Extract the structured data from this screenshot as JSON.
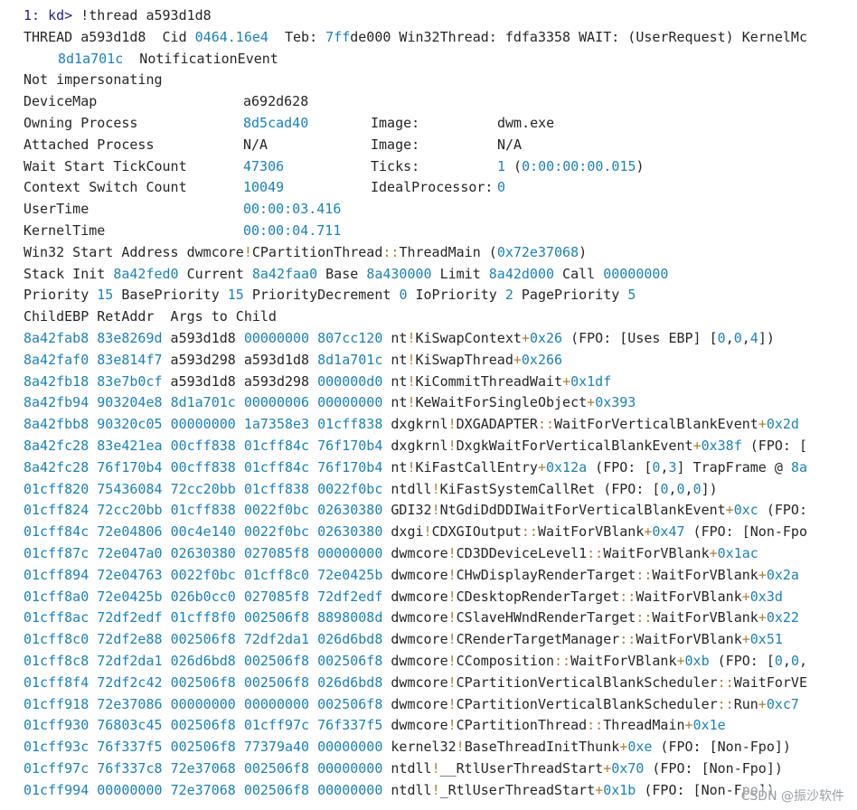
{
  "prompt": "1: kd>",
  "command": "!thread a593d1d8",
  "thread_header": [
    [
      [
        "t",
        "THREAD a593d1d8  Cid "
      ],
      [
        "n",
        "0464.16e4"
      ],
      [
        "t",
        "  Teb: "
      ],
      [
        "n",
        "7ff"
      ],
      [
        "t",
        "de000 Win32Thread: fdfa3358 WAIT: (UserRequest) KernelMc"
      ]
    ],
    [
      [
        "n",
        "8d1a701c"
      ],
      [
        "t",
        "  NotificationEvent"
      ]
    ],
    [
      [
        "t",
        "Not impersonating"
      ]
    ]
  ],
  "props": [
    {
      "label": "DeviceMap",
      "value": "a692d628",
      "value_color": "t",
      "label2": "",
      "value2": ""
    },
    {
      "label": "Owning Process",
      "value": "8d5cad40",
      "value_color": "n",
      "label2": "Image:",
      "value2": "dwm.exe"
    },
    {
      "label": "Attached Process",
      "value": "N/A",
      "value_color": "t",
      "label2": "Image:",
      "value2": "N/A"
    },
    {
      "label": "Wait Start TickCount",
      "value": "47306",
      "value_color": "n",
      "label2": "Ticks:",
      "value2": "1 (0:00:00:00.015)"
    },
    {
      "label": "Context Switch Count",
      "value": "10049",
      "value_color": "n",
      "label2": "IdealProcessor:",
      "value2": "0"
    },
    {
      "label": "UserTime",
      "value": "00:00:03.416",
      "value_color": "n",
      "label2": "",
      "value2": ""
    },
    {
      "label": "KernelTime",
      "value": "00:00:04.711",
      "value_color": "n",
      "label2": "",
      "value2": ""
    }
  ],
  "info_lines": [
    [
      [
        "t",
        "Win32 Start Address dwmcore"
      ],
      [
        "p",
        "!"
      ],
      [
        "t",
        "CPartitionThread"
      ],
      [
        "p",
        "::"
      ],
      [
        "t",
        "ThreadMain ("
      ],
      [
        "n",
        "0x72e37068"
      ],
      [
        "t",
        ")"
      ]
    ],
    [
      [
        "t",
        "Stack Init "
      ],
      [
        "n",
        "8a42fed0"
      ],
      [
        "t",
        " Current "
      ],
      [
        "n",
        "8a42faa0"
      ],
      [
        "t",
        " Base "
      ],
      [
        "n",
        "8a430000"
      ],
      [
        "t",
        " Limit "
      ],
      [
        "n",
        "8a42d000"
      ],
      [
        "t",
        " Call "
      ],
      [
        "n",
        "00000000"
      ]
    ],
    [
      [
        "t",
        "Priority "
      ],
      [
        "n",
        "15"
      ],
      [
        "t",
        " BasePriority "
      ],
      [
        "n",
        "15"
      ],
      [
        "t",
        " PriorityDecrement "
      ],
      [
        "n",
        "0"
      ],
      [
        "t",
        " IoPriority "
      ],
      [
        "n",
        "2"
      ],
      [
        "t",
        " PagePriority "
      ],
      [
        "n",
        "5"
      ]
    ],
    [
      [
        "t",
        "ChildEBP RetAddr  Args to Child"
      ]
    ]
  ],
  "stack_frames": [
    [
      [
        "n",
        "8a42fab8"
      ],
      [
        "t",
        " "
      ],
      [
        "n",
        "83e8269d"
      ],
      [
        "t",
        " a593d1d8 "
      ],
      [
        "n",
        "00000000"
      ],
      [
        "t",
        " "
      ],
      [
        "n",
        "807cc120"
      ],
      [
        "t",
        " nt"
      ],
      [
        "p",
        "!"
      ],
      [
        "t",
        "KiSwapContext"
      ],
      [
        "p",
        "+"
      ],
      [
        "n",
        "0x26"
      ],
      [
        "t",
        " (FPO: [Uses EBP] ["
      ],
      [
        "n",
        "0"
      ],
      [
        "t",
        ","
      ],
      [
        "n",
        "0"
      ],
      [
        "t",
        ","
      ],
      [
        "n",
        "4"
      ],
      [
        "t",
        "])"
      ]
    ],
    [
      [
        "n",
        "8a42faf0"
      ],
      [
        "t",
        " "
      ],
      [
        "n",
        "83e814f7"
      ],
      [
        "t",
        " a593d298 a593d1d8 "
      ],
      [
        "n",
        "8d1a701c"
      ],
      [
        "t",
        " nt"
      ],
      [
        "p",
        "!"
      ],
      [
        "t",
        "KiSwapThread"
      ],
      [
        "p",
        "+"
      ],
      [
        "n",
        "0x266"
      ]
    ],
    [
      [
        "n",
        "8a42fb18"
      ],
      [
        "t",
        " "
      ],
      [
        "n",
        "83e7b0cf"
      ],
      [
        "t",
        " a593d1d8 a593d298 "
      ],
      [
        "n",
        "000000d0"
      ],
      [
        "t",
        " nt"
      ],
      [
        "p",
        "!"
      ],
      [
        "t",
        "KiCommitThreadWait"
      ],
      [
        "p",
        "+"
      ],
      [
        "n",
        "0x1df"
      ]
    ],
    [
      [
        "n",
        "8a42fb94"
      ],
      [
        "t",
        " "
      ],
      [
        "n",
        "903204e8"
      ],
      [
        "t",
        " "
      ],
      [
        "n",
        "8d1a701c"
      ],
      [
        "t",
        " "
      ],
      [
        "n",
        "00000006"
      ],
      [
        "t",
        " "
      ],
      [
        "n",
        "00000000"
      ],
      [
        "t",
        " nt"
      ],
      [
        "p",
        "!"
      ],
      [
        "t",
        "KeWaitForSingleObject"
      ],
      [
        "p",
        "+"
      ],
      [
        "n",
        "0x393"
      ]
    ],
    [
      [
        "n",
        "8a42fbb8"
      ],
      [
        "t",
        " "
      ],
      [
        "n",
        "90320c05"
      ],
      [
        "t",
        " "
      ],
      [
        "n",
        "00000000"
      ],
      [
        "t",
        " "
      ],
      [
        "n",
        "1a7358e3"
      ],
      [
        "t",
        " "
      ],
      [
        "n",
        "01cff838"
      ],
      [
        "t",
        " dxgkrnl"
      ],
      [
        "p",
        "!"
      ],
      [
        "t",
        "DXGADAPTER"
      ],
      [
        "p",
        "::"
      ],
      [
        "t",
        "WaitForVerticalBlankEvent"
      ],
      [
        "p",
        "+"
      ],
      [
        "n",
        "0x2d"
      ]
    ],
    [
      [
        "n",
        "8a42fc28"
      ],
      [
        "t",
        " "
      ],
      [
        "n",
        "83e421ea"
      ],
      [
        "t",
        " "
      ],
      [
        "n",
        "00cff838"
      ],
      [
        "t",
        " "
      ],
      [
        "n",
        "01cff84c"
      ],
      [
        "t",
        " "
      ],
      [
        "n",
        "76f170b4"
      ],
      [
        "t",
        " dxgkrnl"
      ],
      [
        "p",
        "!"
      ],
      [
        "t",
        "DxgkWaitForVerticalBlankEvent"
      ],
      [
        "p",
        "+"
      ],
      [
        "n",
        "0x38f"
      ],
      [
        "t",
        " (FPO: ["
      ]
    ],
    [
      [
        "n",
        "8a42fc28"
      ],
      [
        "t",
        " "
      ],
      [
        "n",
        "76f170b4"
      ],
      [
        "t",
        " "
      ],
      [
        "n",
        "00cff838"
      ],
      [
        "t",
        " "
      ],
      [
        "n",
        "01cff84c"
      ],
      [
        "t",
        " "
      ],
      [
        "n",
        "76f170b4"
      ],
      [
        "t",
        " nt"
      ],
      [
        "p",
        "!"
      ],
      [
        "t",
        "KiFastCallEntry"
      ],
      [
        "p",
        "+"
      ],
      [
        "n",
        "0x12a"
      ],
      [
        "t",
        " (FPO: ["
      ],
      [
        "n",
        "0"
      ],
      [
        "t",
        ","
      ],
      [
        "n",
        "3"
      ],
      [
        "t",
        "] TrapFrame @ "
      ],
      [
        "n",
        "8a"
      ]
    ],
    [
      [
        "n",
        "01cff820"
      ],
      [
        "t",
        " "
      ],
      [
        "n",
        "75436084"
      ],
      [
        "t",
        " "
      ],
      [
        "n",
        "72cc20bb"
      ],
      [
        "t",
        " "
      ],
      [
        "n",
        "01cff838"
      ],
      [
        "t",
        " "
      ],
      [
        "n",
        "0022f0bc"
      ],
      [
        "t",
        " ntdll"
      ],
      [
        "p",
        "!"
      ],
      [
        "t",
        "KiFastSystemCallRet (FPO: ["
      ],
      [
        "n",
        "0"
      ],
      [
        "t",
        ","
      ],
      [
        "n",
        "0"
      ],
      [
        "t",
        ","
      ],
      [
        "n",
        "0"
      ],
      [
        "t",
        "])"
      ]
    ],
    [
      [
        "n",
        "01cff824"
      ],
      [
        "t",
        " "
      ],
      [
        "n",
        "72cc20bb"
      ],
      [
        "t",
        " "
      ],
      [
        "n",
        "01cff838"
      ],
      [
        "t",
        " "
      ],
      [
        "n",
        "0022f0bc"
      ],
      [
        "t",
        " "
      ],
      [
        "n",
        "02630380"
      ],
      [
        "t",
        " GDI32"
      ],
      [
        "p",
        "!"
      ],
      [
        "t",
        "NtGdiDdDDIWaitForVerticalBlankEvent"
      ],
      [
        "p",
        "+"
      ],
      [
        "n",
        "0xc"
      ],
      [
        "t",
        " (FPO:"
      ]
    ],
    [
      [
        "n",
        "01cff84c"
      ],
      [
        "t",
        " "
      ],
      [
        "n",
        "72e04806"
      ],
      [
        "t",
        " "
      ],
      [
        "n",
        "00c4e140"
      ],
      [
        "t",
        " "
      ],
      [
        "n",
        "0022f0bc"
      ],
      [
        "t",
        " "
      ],
      [
        "n",
        "02630380"
      ],
      [
        "t",
        " dxgi"
      ],
      [
        "p",
        "!"
      ],
      [
        "t",
        "CDXGIOutput"
      ],
      [
        "p",
        "::"
      ],
      [
        "t",
        "WaitForVBlank"
      ],
      [
        "p",
        "+"
      ],
      [
        "n",
        "0x47"
      ],
      [
        "t",
        " (FPO: [Non-Fpo"
      ]
    ],
    [
      [
        "n",
        "01cff87c"
      ],
      [
        "t",
        " "
      ],
      [
        "n",
        "72e047a0"
      ],
      [
        "t",
        " "
      ],
      [
        "n",
        "02630380"
      ],
      [
        "t",
        " "
      ],
      [
        "n",
        "027085f8"
      ],
      [
        "t",
        " "
      ],
      [
        "n",
        "00000000"
      ],
      [
        "t",
        " dwmcore"
      ],
      [
        "p",
        "!"
      ],
      [
        "t",
        "CD3DDeviceLevel1"
      ],
      [
        "p",
        "::"
      ],
      [
        "t",
        "WaitForVBlank"
      ],
      [
        "p",
        "+"
      ],
      [
        "n",
        "0x1ac"
      ]
    ],
    [
      [
        "n",
        "01cff894"
      ],
      [
        "t",
        " "
      ],
      [
        "n",
        "72e04763"
      ],
      [
        "t",
        " "
      ],
      [
        "n",
        "0022f0bc"
      ],
      [
        "t",
        " "
      ],
      [
        "n",
        "01cff8c0"
      ],
      [
        "t",
        " "
      ],
      [
        "n",
        "72e0425b"
      ],
      [
        "t",
        " dwmcore"
      ],
      [
        "p",
        "!"
      ],
      [
        "t",
        "CHwDisplayRenderTarget"
      ],
      [
        "p",
        "::"
      ],
      [
        "t",
        "WaitForVBlank"
      ],
      [
        "p",
        "+"
      ],
      [
        "n",
        "0x2a"
      ]
    ],
    [
      [
        "n",
        "01cff8a0"
      ],
      [
        "t",
        " "
      ],
      [
        "n",
        "72e0425b"
      ],
      [
        "t",
        " "
      ],
      [
        "n",
        "026b0cc0"
      ],
      [
        "t",
        " "
      ],
      [
        "n",
        "027085f8"
      ],
      [
        "t",
        " "
      ],
      [
        "n",
        "72df2edf"
      ],
      [
        "t",
        " dwmcore"
      ],
      [
        "p",
        "!"
      ],
      [
        "t",
        "CDesktopRenderTarget"
      ],
      [
        "p",
        "::"
      ],
      [
        "t",
        "WaitForVBlank"
      ],
      [
        "p",
        "+"
      ],
      [
        "n",
        "0x3d"
      ]
    ],
    [
      [
        "n",
        "01cff8ac"
      ],
      [
        "t",
        " "
      ],
      [
        "n",
        "72df2edf"
      ],
      [
        "t",
        " "
      ],
      [
        "n",
        "01cff8f0"
      ],
      [
        "t",
        " "
      ],
      [
        "n",
        "002506f8"
      ],
      [
        "t",
        " "
      ],
      [
        "n",
        "8898008d"
      ],
      [
        "t",
        " dwmcore"
      ],
      [
        "p",
        "!"
      ],
      [
        "t",
        "CSlaveHWndRenderTarget"
      ],
      [
        "p",
        "::"
      ],
      [
        "t",
        "WaitForVBlank"
      ],
      [
        "p",
        "+"
      ],
      [
        "n",
        "0x22"
      ]
    ],
    [
      [
        "n",
        "01cff8c0"
      ],
      [
        "t",
        " "
      ],
      [
        "n",
        "72df2e88"
      ],
      [
        "t",
        " "
      ],
      [
        "n",
        "002506f8"
      ],
      [
        "t",
        " "
      ],
      [
        "n",
        "72df2da1"
      ],
      [
        "t",
        " "
      ],
      [
        "n",
        "026d6bd8"
      ],
      [
        "t",
        " dwmcore"
      ],
      [
        "p",
        "!"
      ],
      [
        "t",
        "CRenderTargetManager"
      ],
      [
        "p",
        "::"
      ],
      [
        "t",
        "WaitForVBlank"
      ],
      [
        "p",
        "+"
      ],
      [
        "n",
        "0x51"
      ]
    ],
    [
      [
        "n",
        "01cff8c8"
      ],
      [
        "t",
        " "
      ],
      [
        "n",
        "72df2da1"
      ],
      [
        "t",
        " "
      ],
      [
        "n",
        "026d6bd8"
      ],
      [
        "t",
        " "
      ],
      [
        "n",
        "002506f8"
      ],
      [
        "t",
        " "
      ],
      [
        "n",
        "002506f8"
      ],
      [
        "t",
        " dwmcore"
      ],
      [
        "p",
        "!"
      ],
      [
        "t",
        "CComposition"
      ],
      [
        "p",
        "::"
      ],
      [
        "t",
        "WaitForVBlank"
      ],
      [
        "p",
        "+"
      ],
      [
        "n",
        "0xb"
      ],
      [
        "t",
        " (FPO: ["
      ],
      [
        "n",
        "0"
      ],
      [
        "t",
        ","
      ],
      [
        "n",
        "0"
      ],
      [
        "t",
        ","
      ]
    ],
    [
      [
        "n",
        "01cff8f4"
      ],
      [
        "t",
        " "
      ],
      [
        "n",
        "72df2c42"
      ],
      [
        "t",
        " "
      ],
      [
        "n",
        "002506f8"
      ],
      [
        "t",
        " "
      ],
      [
        "n",
        "002506f8"
      ],
      [
        "t",
        " "
      ],
      [
        "n",
        "026d6bd8"
      ],
      [
        "t",
        " dwmcore"
      ],
      [
        "p",
        "!"
      ],
      [
        "t",
        "CPartitionVerticalBlankScheduler"
      ],
      [
        "p",
        "::"
      ],
      [
        "t",
        "WaitForVE"
      ]
    ],
    [
      [
        "n",
        "01cff918"
      ],
      [
        "t",
        " "
      ],
      [
        "n",
        "72e37086"
      ],
      [
        "t",
        " "
      ],
      [
        "n",
        "00000000"
      ],
      [
        "t",
        " "
      ],
      [
        "n",
        "00000000"
      ],
      [
        "t",
        " "
      ],
      [
        "n",
        "002506f8"
      ],
      [
        "t",
        " dwmcore"
      ],
      [
        "p",
        "!"
      ],
      [
        "t",
        "CPartitionVerticalBlankScheduler"
      ],
      [
        "p",
        "::"
      ],
      [
        "t",
        "Run"
      ],
      [
        "p",
        "+"
      ],
      [
        "n",
        "0xc7"
      ]
    ],
    [
      [
        "n",
        "01cff930"
      ],
      [
        "t",
        " "
      ],
      [
        "n",
        "76803c45"
      ],
      [
        "t",
        " "
      ],
      [
        "n",
        "002506f8"
      ],
      [
        "t",
        " "
      ],
      [
        "n",
        "01cff97c"
      ],
      [
        "t",
        " "
      ],
      [
        "n",
        "76f337f5"
      ],
      [
        "t",
        " dwmcore"
      ],
      [
        "p",
        "!"
      ],
      [
        "t",
        "CPartitionThread"
      ],
      [
        "p",
        "::"
      ],
      [
        "t",
        "ThreadMain"
      ],
      [
        "p",
        "+"
      ],
      [
        "n",
        "0x1e"
      ]
    ],
    [
      [
        "n",
        "01cff93c"
      ],
      [
        "t",
        " "
      ],
      [
        "n",
        "76f337f5"
      ],
      [
        "t",
        " "
      ],
      [
        "n",
        "002506f8"
      ],
      [
        "t",
        " "
      ],
      [
        "n",
        "77379a40"
      ],
      [
        "t",
        " "
      ],
      [
        "n",
        "00000000"
      ],
      [
        "t",
        " kernel32"
      ],
      [
        "p",
        "!"
      ],
      [
        "t",
        "BaseThreadInitThunk"
      ],
      [
        "p",
        "+"
      ],
      [
        "n",
        "0xe"
      ],
      [
        "t",
        " (FPO: [Non-Fpo])"
      ]
    ],
    [
      [
        "n",
        "01cff97c"
      ],
      [
        "t",
        " "
      ],
      [
        "n",
        "76f337c8"
      ],
      [
        "t",
        " "
      ],
      [
        "n",
        "72e37068"
      ],
      [
        "t",
        " "
      ],
      [
        "n",
        "002506f8"
      ],
      [
        "t",
        " "
      ],
      [
        "n",
        "00000000"
      ],
      [
        "t",
        " ntdll"
      ],
      [
        "p",
        "!"
      ],
      [
        "t",
        "__RtlUserThreadStart"
      ],
      [
        "p",
        "+"
      ],
      [
        "n",
        "0x70"
      ],
      [
        "t",
        " (FPO: [Non-Fpo])"
      ]
    ],
    [
      [
        "n",
        "01cff994"
      ],
      [
        "t",
        " "
      ],
      [
        "n",
        "00000000"
      ],
      [
        "t",
        " "
      ],
      [
        "n",
        "72e37068"
      ],
      [
        "t",
        " "
      ],
      [
        "n",
        "002506f8"
      ],
      [
        "t",
        " "
      ],
      [
        "n",
        "00000000"
      ],
      [
        "t",
        " ntdll"
      ],
      [
        "p",
        "!"
      ],
      [
        "t",
        "_RtlUserThreadStart"
      ],
      [
        "p",
        "+"
      ],
      [
        "n",
        "0x1b"
      ],
      [
        "t",
        " (FPO: [Non-Fpo])"
      ]
    ]
  ],
  "watermark": "CSDN @振沙软件",
  "colors": {
    "text": "#262626",
    "number": "#1a82b8",
    "punct": "#b07d32",
    "prompt": "#1f1f9e",
    "background": "#ffffff"
  }
}
